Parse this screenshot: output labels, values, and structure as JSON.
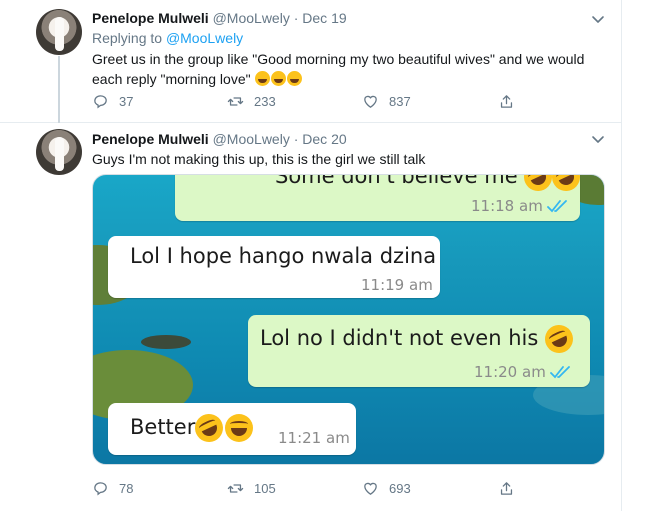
{
  "tweets": [
    {
      "author_name": "Penelope Mulweli",
      "author_handle": "@MooLwely",
      "date": "· Dec 19",
      "replying_label": "Replying to",
      "replying_handle": "@MooLwely",
      "text_line1": "Greet us in the group like \"Good morning my two beautiful wives\" and we would",
      "text_line2": "each reply \"morning love\"",
      "emojis": [
        "joy-emoji",
        "rofl-emoji",
        "rofl-emoji"
      ],
      "replies": "37",
      "retweets": "233",
      "likes": "837"
    },
    {
      "author_name": "Penelope Mulweli",
      "author_handle": "@MooLwely",
      "date": "· Dec 20",
      "text": "Guys I'm not making this up, this  is the girl we still talk",
      "replies": "78",
      "retweets": "105",
      "likes": "693"
    }
  ],
  "chat": {
    "messages": [
      {
        "direction": "out",
        "text": "Some don't believe me",
        "time": "11:18 am",
        "read": true
      },
      {
        "direction": "in",
        "text": "Lol I hope hango nwala dzina",
        "time": "11:19 am"
      },
      {
        "direction": "out",
        "text": "Lol no I didn't not even his",
        "time": "11:20 am",
        "read": true
      },
      {
        "direction": "in",
        "text": "Better",
        "time": "11:21 am"
      }
    ]
  },
  "colors": {
    "link": "#1da1f2",
    "muted": "#657786",
    "outgoing_bubble": "#dcf8c6",
    "read_ticks": "#34b7f1"
  }
}
